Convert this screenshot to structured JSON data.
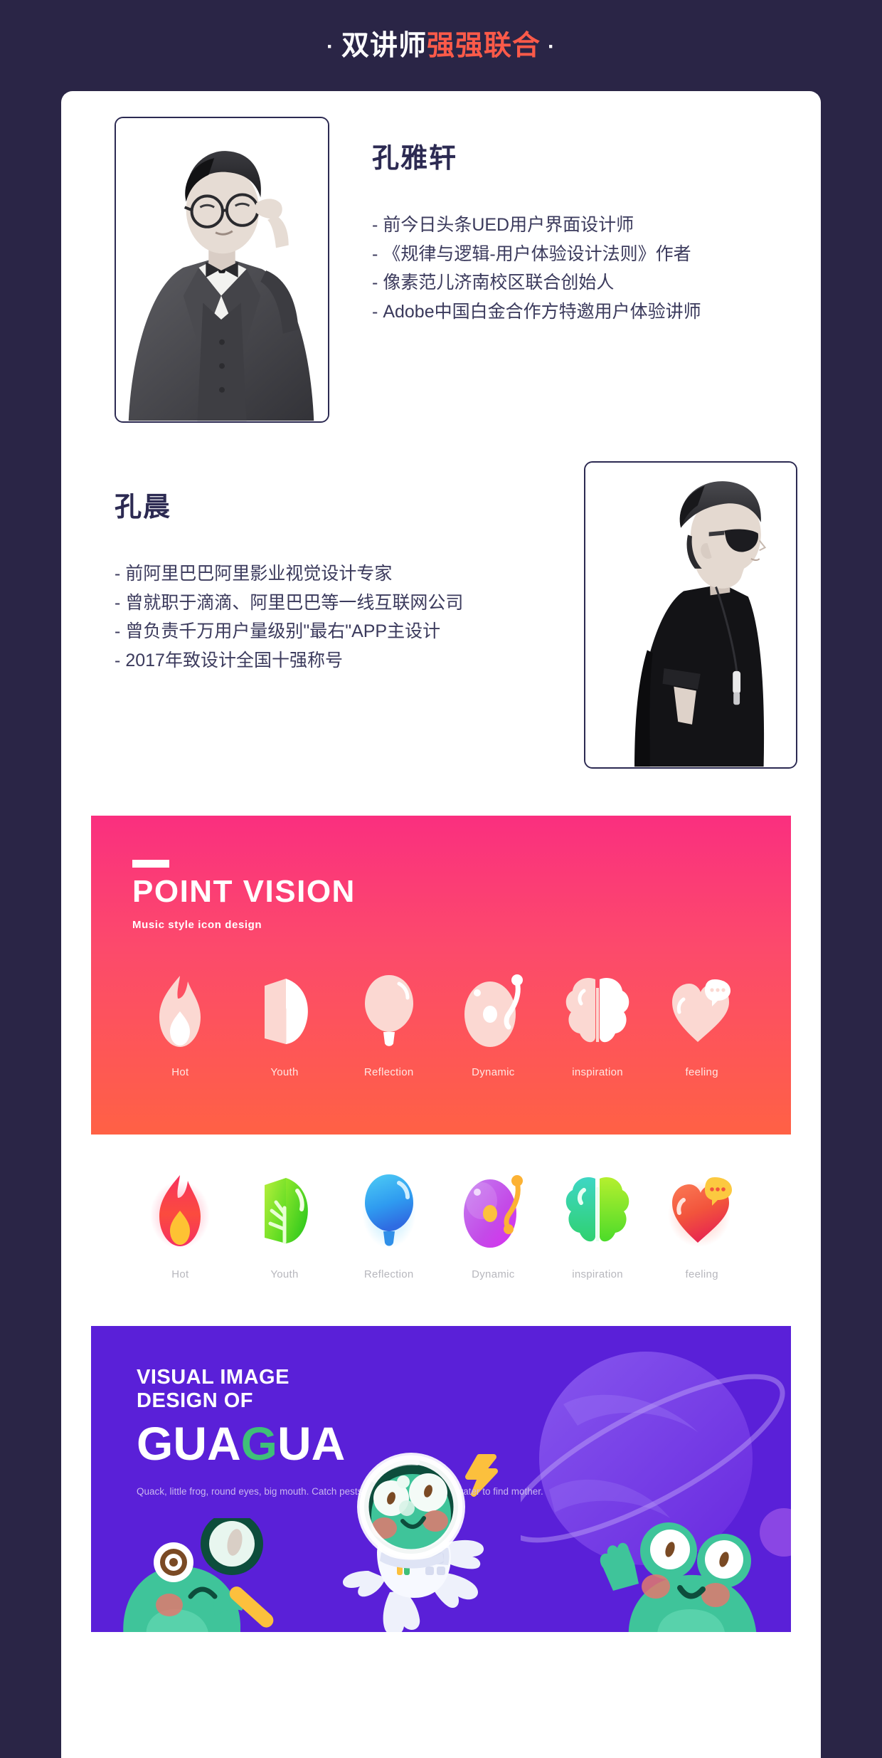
{
  "header": {
    "dot": "·",
    "title_white": "双讲师",
    "title_accent": "强强联合",
    "accent_color": "#fb5a49",
    "background_color": "#2a2546"
  },
  "instructors": [
    {
      "name": "孔雅轩",
      "photo_alt": "man-in-suit-with-glasses-portrait",
      "bullets": [
        "前今日头条UED用户界面设计师",
        "《规律与逻辑-用户体验设计法则》作者",
        "像素范儿济南校区联合创始人",
        "Adobe中国白金合作方特邀用户体验讲师"
      ],
      "dash": "-"
    },
    {
      "name": "孔晨",
      "photo_alt": "man-in-black-tshirt-sunglasses-portrait",
      "bullets": [
        "前阿里巴巴阿里影业视觉设计专家",
        "曾就职于滴滴、阿里巴巴等一线互联网公司",
        "曾负责千万用户量级别\"最右\"APP主设计",
        "2017年致设计全国十强称号"
      ],
      "dash": "-"
    }
  ],
  "point_vision": {
    "title": "POINT VISION",
    "subtitle": "Music style icon design",
    "gradient_from": "#fa2f7f",
    "gradient_to": "#ff6145",
    "icons": [
      {
        "name": "flame-icon",
        "caption": "Hot"
      },
      {
        "name": "leaf-icon",
        "caption": "Youth"
      },
      {
        "name": "lightbulb-icon",
        "caption": "Reflection"
      },
      {
        "name": "record-icon",
        "caption": "Dynamic"
      },
      {
        "name": "brain-icon",
        "caption": "inspiration"
      },
      {
        "name": "heart-icon",
        "caption": "feeling"
      }
    ]
  },
  "color_icons": {
    "icons": [
      {
        "name": "flame-icon",
        "caption": "Hot",
        "color": "#f8325f"
      },
      {
        "name": "leaf-icon",
        "caption": "Youth",
        "color": "#52d715"
      },
      {
        "name": "lightbulb-icon",
        "caption": "Reflection",
        "color": "#2e9bf0"
      },
      {
        "name": "record-icon",
        "caption": "Dynamic",
        "color": "#c44ae8"
      },
      {
        "name": "brain-icon",
        "caption": "inspiration",
        "color": "#2fd18a"
      },
      {
        "name": "heart-icon",
        "caption": "feeling",
        "color": "#f2543c"
      }
    ]
  },
  "guagua": {
    "line1": "VISUAL IMAGE",
    "line2": "DESIGN OF",
    "word_pre": "GUA",
    "word_g": "G",
    "word_post": "UA",
    "g_color": "#3fbf78",
    "background_color": "#5a20d8",
    "description": "Quack, little frog, round eyes, big mouth. Catch pests, quack, jump into the water to find mother.",
    "mascots": [
      "detective-frog-with-magnifier",
      "astronaut-frog",
      "waving-frog"
    ]
  }
}
